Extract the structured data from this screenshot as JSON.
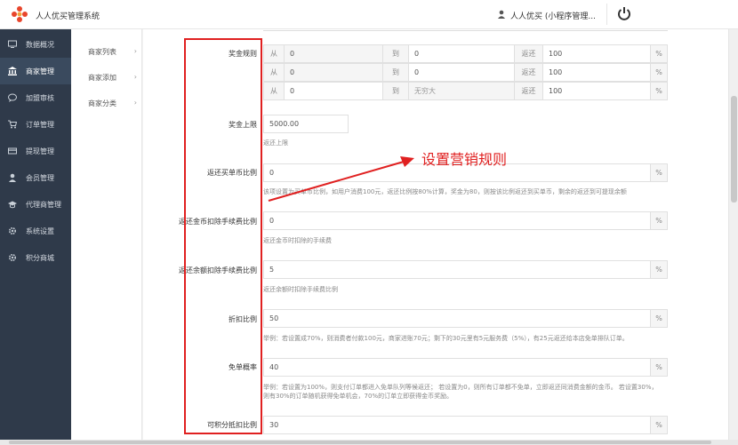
{
  "header": {
    "app_title": "人人优买管理系统",
    "user_name": "人人优买 (小程序管理..."
  },
  "sidebar": {
    "items": [
      {
        "label": "数据概况",
        "icon": "monitor-icon",
        "active": false
      },
      {
        "label": "商家管理",
        "icon": "bank-icon",
        "active": true
      },
      {
        "label": "加盟审核",
        "icon": "chat-icon",
        "active": false
      },
      {
        "label": "订单管理",
        "icon": "cart-icon",
        "active": false
      },
      {
        "label": "提现管理",
        "icon": "card-icon",
        "active": false
      },
      {
        "label": "会员管理",
        "icon": "user-icon",
        "active": false
      },
      {
        "label": "代理商管理",
        "icon": "graduation-icon",
        "active": false
      },
      {
        "label": "系统设置",
        "icon": "gear-icon",
        "active": false
      },
      {
        "label": "积分商城",
        "icon": "gear-icon",
        "active": false
      }
    ]
  },
  "subnav": {
    "items": [
      {
        "label": "商家列表",
        "chev": "›"
      },
      {
        "label": "商家添加",
        "chev": "›"
      },
      {
        "label": "商家分类",
        "chev": "›"
      }
    ]
  },
  "form": {
    "reward_rules": {
      "label": "奖金规则",
      "rows": [
        {
          "from_label": "从",
          "from": "0",
          "to_label": "到",
          "to": "0",
          "ret_label": "返还",
          "ret": "100",
          "pct": "%"
        },
        {
          "from_label": "从",
          "from": "0",
          "to_label": "到",
          "to": "0",
          "ret_label": "返还",
          "ret": "100",
          "pct": "%"
        },
        {
          "from_label": "从",
          "from": "0",
          "to_label": "到",
          "to": "无穷大",
          "ret_label": "返还",
          "ret": "100",
          "pct": "%"
        }
      ]
    },
    "reward_cap": {
      "label": "奖金上限",
      "value": "5000.00",
      "help": "返还上限"
    },
    "coin_ratio": {
      "label": "返还买单币比例",
      "value": "0",
      "pct": "%",
      "help": "该项设置为买单币比例，如用户消费100元，返还比例按80%计算，奖金为80，则按该比例返还到买单币，剩余的返还到可提现余额"
    },
    "gold_fee": {
      "label": "返还金币扣除手续费比例",
      "value": "0",
      "pct": "%",
      "help": "返还金币时扣除的手续费"
    },
    "balance_fee": {
      "label": "返还余额扣除手续费比例",
      "value": "5",
      "pct": "%",
      "help": "返还余额时扣除手续费比例"
    },
    "discount": {
      "label": "折扣比例",
      "value": "50",
      "pct": "%",
      "help": "举例：若设置成70%，则消费者付款100元，商家进账70元；剩下的30元里有5元服务费（5%），有25元返还给本店免单排队订单。"
    },
    "free_rate": {
      "label": "免单概率",
      "value": "40",
      "pct": "%",
      "help1": "举例：若设置为100%，则支付订单都进入免单队列等候返还； 若设置为0，则所有订单都不免单，立即返还同消费金额的金币。 若设置30%，",
      "help2": "则有30%的订单随机获得免单机会，70%的订单立即获得金币奖励。"
    },
    "points": {
      "label": "可积分抵扣比例",
      "value": "30",
      "pct": "%"
    }
  },
  "annotation": {
    "text": "设置营销规则"
  },
  "colors": {
    "sidebar_bg": "#2f3a4a",
    "accent_red": "#e02020"
  }
}
